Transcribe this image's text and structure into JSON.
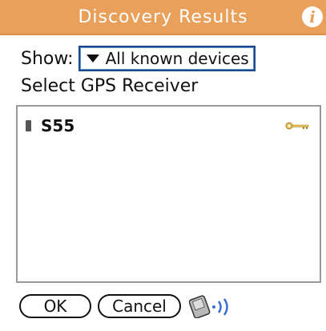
{
  "title_bar": {
    "title": "Discovery Results",
    "info_icon": "info-icon",
    "background_color": "#e8a05a"
  },
  "show_filter": {
    "label": "Show:",
    "selected_value": "All known devices"
  },
  "heading": "Select GPS Receiver",
  "device_list": {
    "items": [
      {
        "name": "S55",
        "trusted_icon": "key-icon"
      }
    ]
  },
  "buttons": {
    "ok_label": "OK",
    "cancel_label": "Cancel"
  },
  "beam_icon": "handheld-beam-icon"
}
